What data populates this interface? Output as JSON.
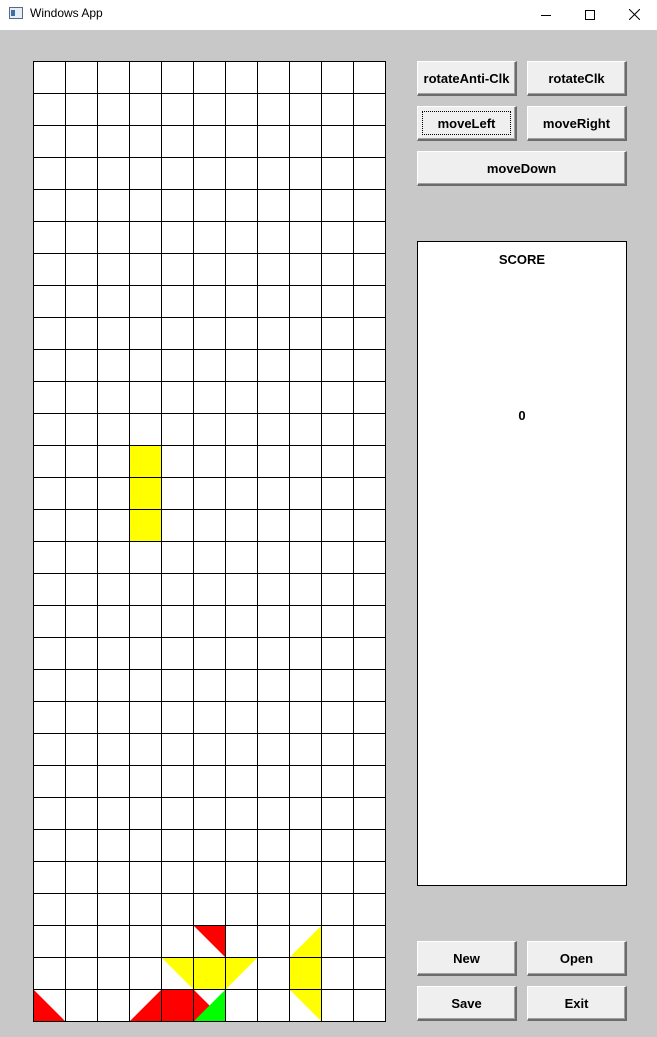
{
  "window": {
    "title": "Windows App",
    "icon": "app-window-icon",
    "controls": [
      "minimize-icon",
      "maximize-icon",
      "close-icon"
    ]
  },
  "controls": {
    "rotate_anti_clk": "rotateAnti-Clk",
    "rotate_clk": "rotateClk",
    "move_left": "moveLeft",
    "move_right": "moveRight",
    "move_down": "moveDown"
  },
  "score": {
    "title": "SCORE",
    "value": "0"
  },
  "file": {
    "new": "New",
    "open": "Open",
    "save": "Save",
    "exit": "Exit"
  },
  "board": {
    "columns": 11,
    "rows": 30,
    "colors": {
      "yellow": "#ffff00",
      "red": "#ff0000",
      "green": "#00ff00",
      "grid": "#000000",
      "cell": "#ffffff"
    },
    "pieces": [
      {
        "color": "yellow",
        "cells": [
          [
            12,
            3
          ],
          [
            13,
            3
          ],
          [
            14,
            3
          ]
        ]
      },
      {
        "color": "red",
        "cells": [
          [
            27,
            5
          ]
        ],
        "shape": "triangle-upper-right"
      },
      {
        "color": "yellow",
        "cells": [
          [
            28,
            4
          ],
          [
            28,
            5
          ],
          [
            28,
            6
          ]
        ],
        "shape": "trapezoid-down"
      },
      {
        "color": "yellow",
        "cells": [
          [
            27,
            8
          ],
          [
            28,
            8
          ],
          [
            29,
            8
          ]
        ],
        "shape": "trapezoid-left"
      },
      {
        "color": "red",
        "cells": [
          [
            29,
            0
          ]
        ],
        "shape": "triangle-lower-left"
      },
      {
        "color": "red",
        "cells": [
          [
            29,
            3
          ],
          [
            29,
            4
          ],
          [
            29,
            5
          ]
        ],
        "shape": "trapezoid-up"
      },
      {
        "color": "green",
        "cells": [
          [
            29,
            5
          ]
        ],
        "shape": "triangle-lower-right"
      }
    ]
  }
}
